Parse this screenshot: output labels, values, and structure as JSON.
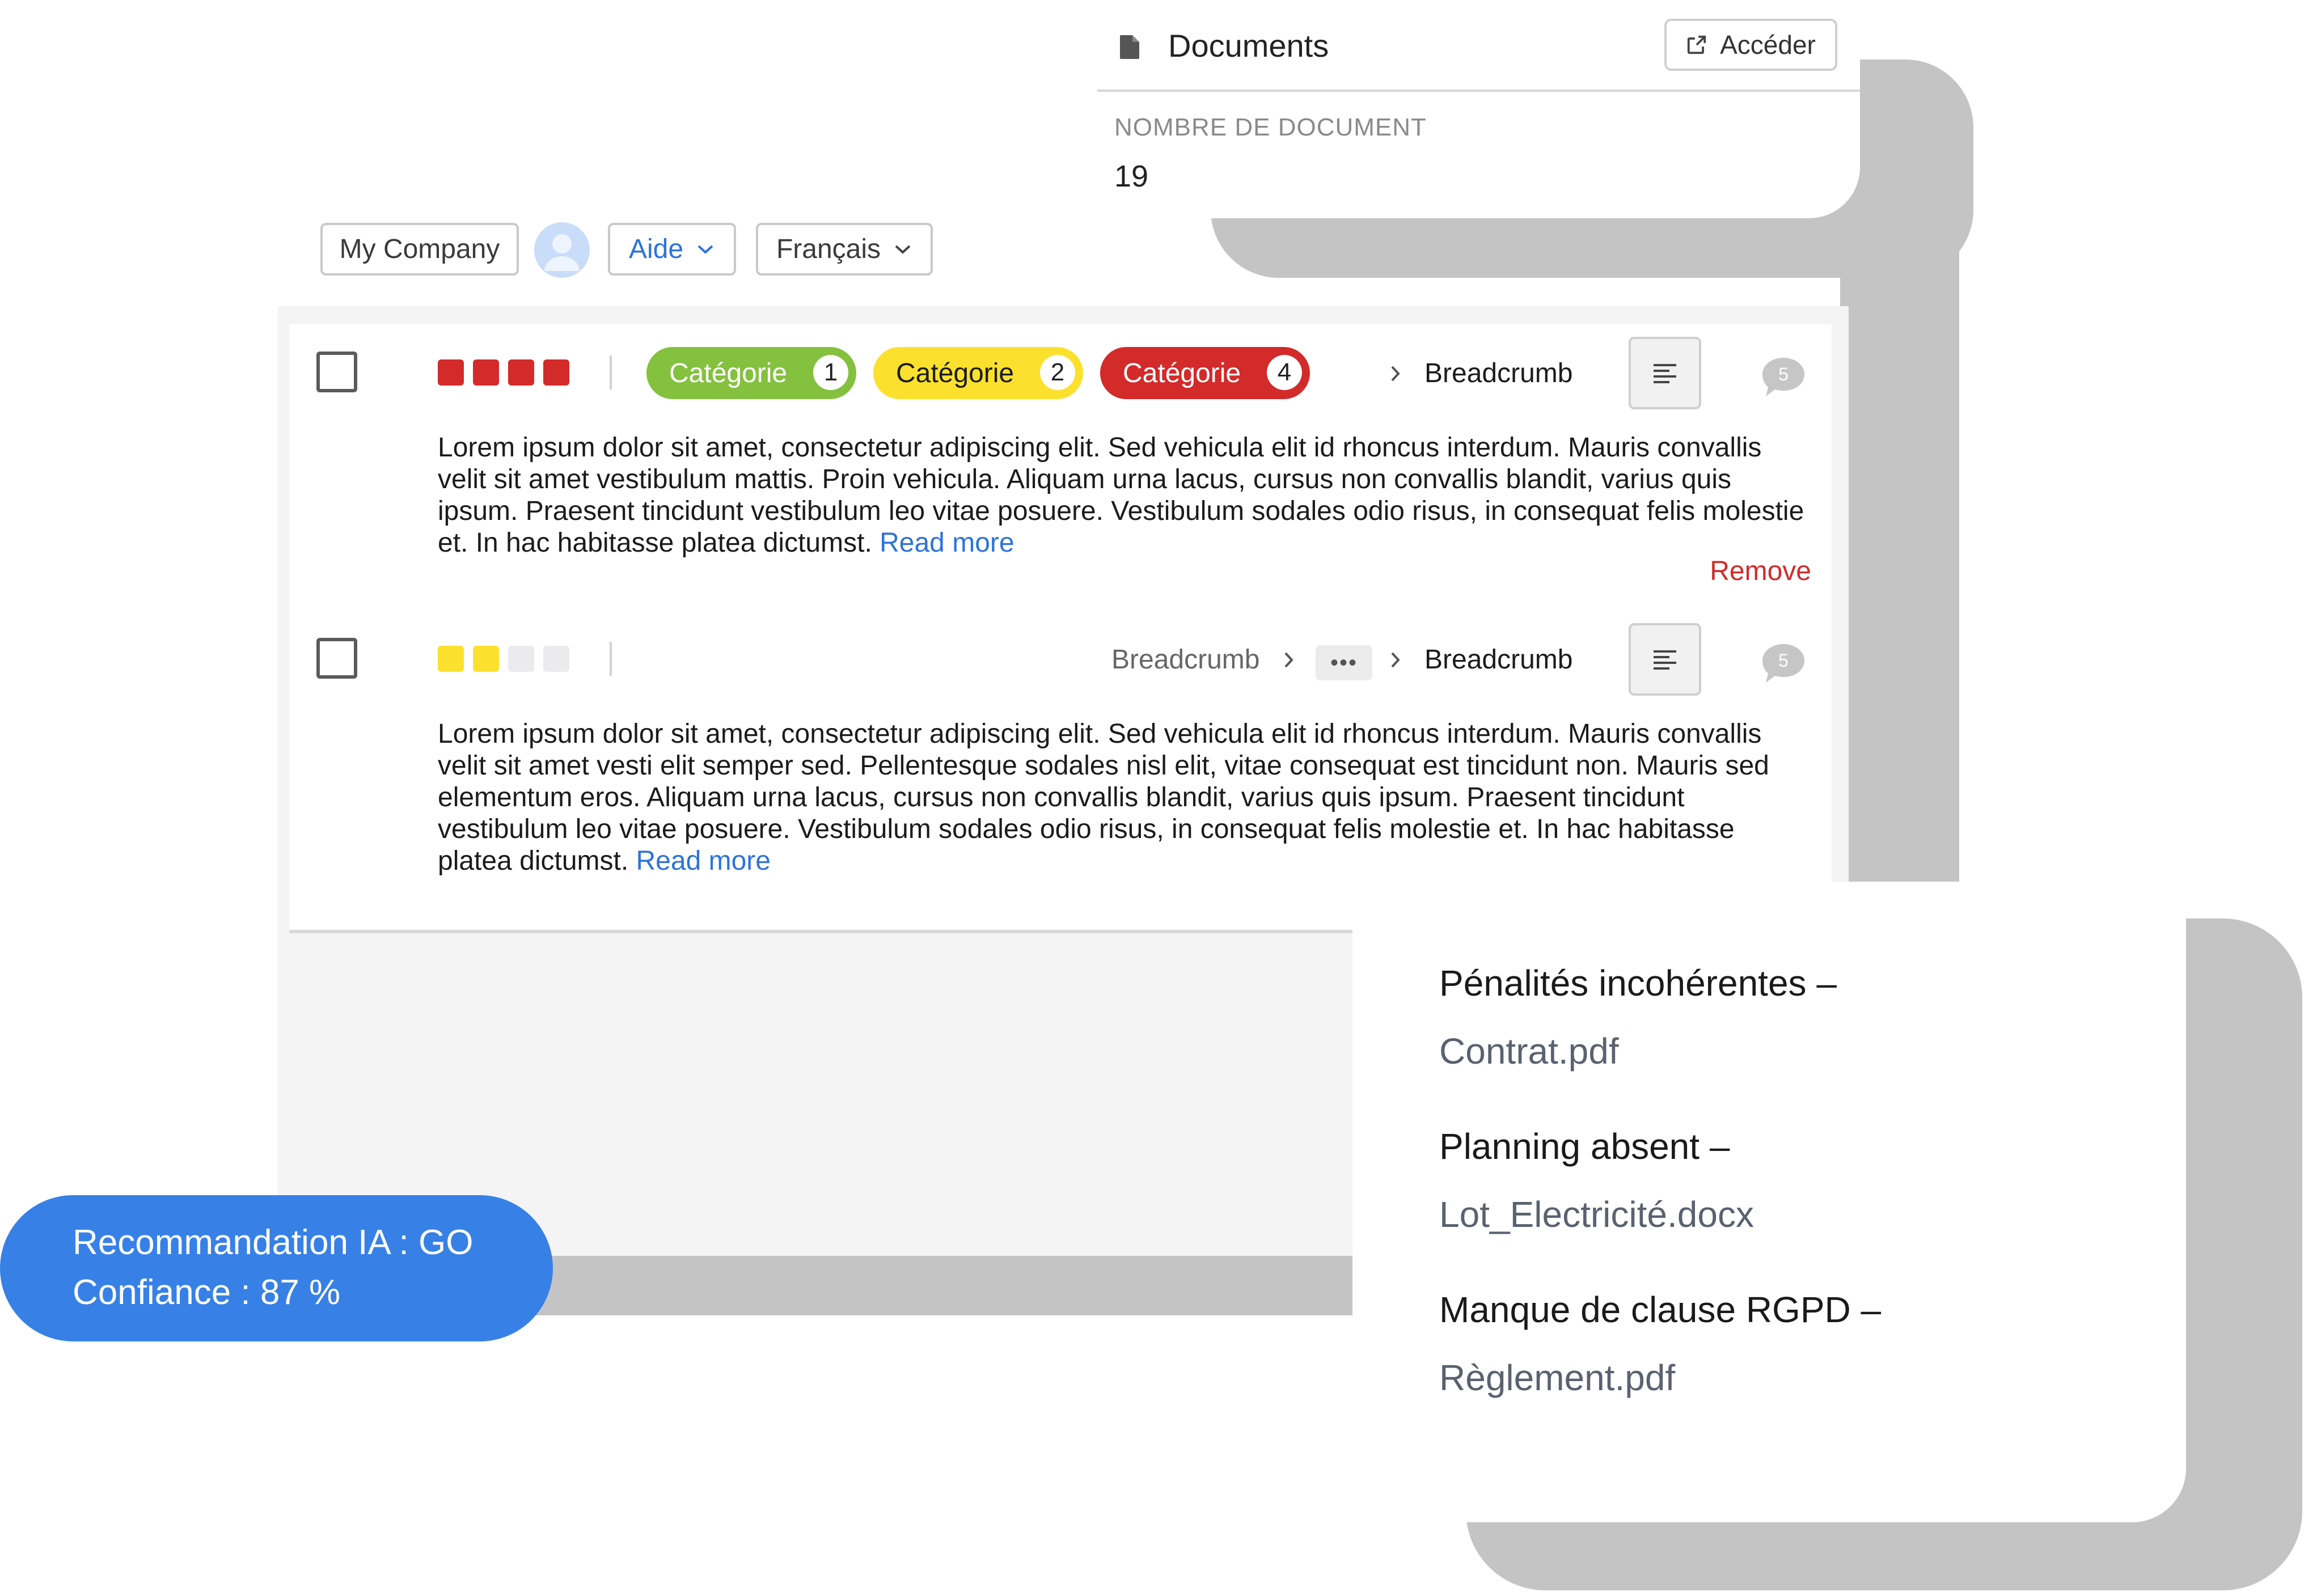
{
  "documents": {
    "title": "Documents",
    "open_label": "Accéder",
    "count_label": "NOMBRE DE DOCUMENT",
    "count_value": "19"
  },
  "toolbar": {
    "company_label": "My Company",
    "help_label": "Aide",
    "language_label": "Français"
  },
  "rows": [
    {
      "severity": [
        "#d32a2a",
        "#d32a2a",
        "#d32a2a",
        "#d32a2a"
      ],
      "severity_level": 4,
      "categories": [
        {
          "label": "Catégorie",
          "count": "1",
          "color": "#84c13f",
          "text_color": "#ffffff"
        },
        {
          "label": "Catégorie",
          "count": "2",
          "color": "#fbe12e",
          "text_color": "#1b1b1b"
        },
        {
          "label": "Catégorie",
          "count": "4",
          "color": "#d32a2a",
          "text_color": "#ffffff"
        }
      ],
      "breadcrumb": [
        "Breadcrumb"
      ],
      "comment_count": "5",
      "text": "Lorem ipsum dolor sit amet, consectetur adipiscing elit. Sed vehicula elit id rhoncus interdum. Mauris convallis velit sit amet vestibulum mattis. Proin vehicula. Aliquam urna lacus, cursus non convallis blandit, varius quis ipsum. Praesent tincidunt vestibulum leo vitae posuere. Vestibulum sodales odio risus, in consequat felis molestie et. In hac habitasse platea dictumst.",
      "read_more": "Read more",
      "remove_label": "Remove"
    },
    {
      "severity": [
        "#fbe12e",
        "#fbe12e",
        "#ebebee",
        "#ebebee"
      ],
      "severity_level": 2,
      "breadcrumb": [
        "Breadcrumb",
        "•••",
        "Breadcrumb"
      ],
      "comment_count": "5",
      "text": "Lorem ipsum dolor sit amet, consectetur adipiscing elit. Sed vehicula elit id rhoncus interdum. Mauris convallis velit sit amet vesti elit semper sed. Pellentesque sodales nisl elit, vitae consequat est tincidunt non. Mauris sed elementum eros. Aliquam urna lacus, cursus non convallis blandit, varius quis ipsum. Praesent tincidunt vestibulum leo vitae posuere. Vestibulum sodales odio risus, in consequat felis molestie et. In hac habitasse platea dictumst.",
      "read_more": "Read more"
    }
  ],
  "issues": [
    {
      "title": "Pénalités incohérentes –",
      "file": "Contrat.pdf"
    },
    {
      "title": "Planning absent –",
      "file": "Lot_Electricité.docx"
    },
    {
      "title": "Manque de clause RGPD –",
      "file": "Règlement.pdf"
    }
  ],
  "ai_badge": {
    "line1": "Recommandation IA : GO",
    "line2": "Confiance : 87 %",
    "color": "#3781e6"
  },
  "icons": {
    "document": "document-icon",
    "open": "external-link-icon",
    "chevron": "chevron-down-icon",
    "breadcrumb_sep": "chevron-right-icon",
    "align": "align-left-icon",
    "comment": "comment-icon",
    "avatar": "user-avatar-icon"
  }
}
